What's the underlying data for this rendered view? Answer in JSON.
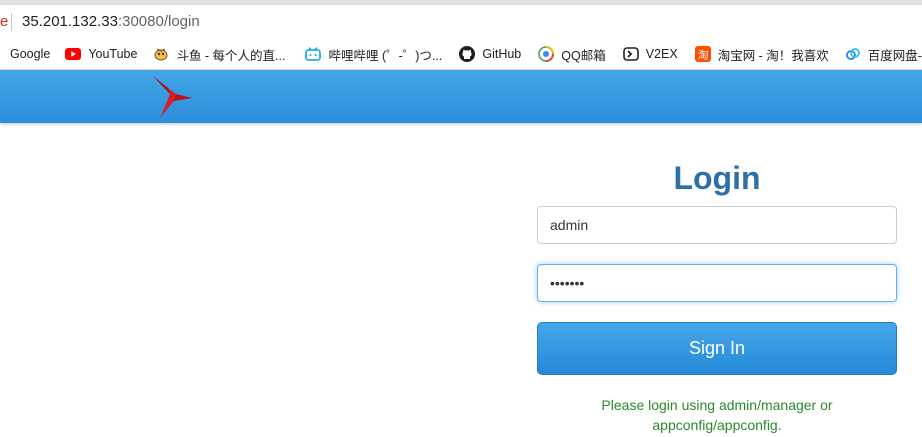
{
  "browser": {
    "address": {
      "host": "35.201.132.33",
      "port_path": ":30080/login",
      "left_mark": "e"
    },
    "bookmarks": [
      {
        "label": "Google",
        "icon": "google-icon"
      },
      {
        "label": "YouTube",
        "icon": "youtube-icon"
      },
      {
        "label": "斗鱼 - 每个人的直...",
        "icon": "douyu-icon"
      },
      {
        "label": "哔哩哔哩 (゜-゜)つ...",
        "icon": "bilibili-icon"
      },
      {
        "label": "GitHub",
        "icon": "github-icon"
      },
      {
        "label": "QQ邮箱",
        "icon": "qqmail-icon"
      },
      {
        "label": "V2EX",
        "icon": "v2ex-icon"
      },
      {
        "label": "淘宝网 - 淘！我喜欢",
        "icon": "taobao-icon"
      },
      {
        "label": "百度网盘-",
        "icon": "baidu-pan-icon"
      }
    ]
  },
  "app": {
    "header_color": "#3a9ce2",
    "logo_icon": "bird-logo-icon",
    "login": {
      "title": "Login",
      "username": "admin",
      "password_mask": "•••••••",
      "submit_label": "Sign In",
      "hint": "Please login using admin/manager or appconfig/appconfig."
    }
  }
}
